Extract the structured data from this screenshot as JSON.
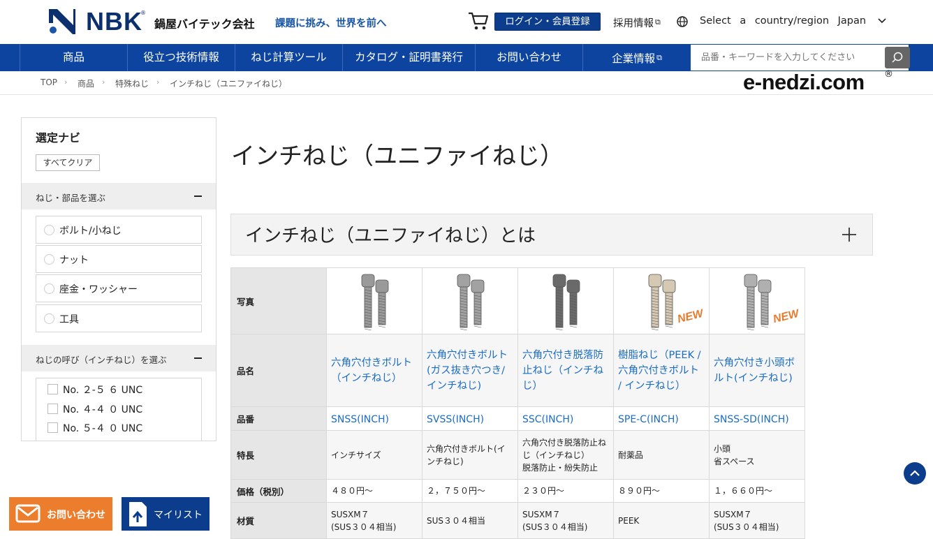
{
  "header": {
    "brand": "NBK",
    "brand_reg": "®",
    "company": "鍋屋バイテック会社",
    "tagline": "課題に挑み、世界を前へ",
    "login_label": "ログイン・会員登録",
    "recruit_label": "採用情報",
    "country_label": "Select a country/region Japan"
  },
  "nav": {
    "items": [
      "商品",
      "役立つ技術情報",
      "ねじ計算ツール",
      "カタログ・証明書発行",
      "お問い合わせ",
      "企業情報"
    ],
    "search_placeholder": "品番・キーワードを入力してください"
  },
  "breadcrumb": [
    "TOP",
    "商品",
    "特殊ねじ",
    "インチねじ（ユニファイねじ）"
  ],
  "site_logo": {
    "text": "e-nedzi.com",
    "reg": "®"
  },
  "sidebar": {
    "title": "選定ナビ",
    "clear_label": "すべてクリア",
    "section1": "ねじ・部品を選ぶ",
    "parts": [
      "ボルト/小ねじ",
      "ナット",
      "座金・ワッシャー",
      "工具"
    ],
    "section2": "ねじの呼び（インチねじ）を選ぶ",
    "sizes": [
      "No. ２‐５ ６ UNC",
      "No. ４‐４ ０ UNC",
      "No. ５‐４ ０ UNC"
    ]
  },
  "main": {
    "title": "インチねじ（ユニファイねじ）",
    "about_title": "インチねじ（ユニファイねじ）とは"
  },
  "table": {
    "row_labels": {
      "photo": "写真",
      "name": "品名",
      "code": "品番",
      "feature": "特長",
      "price": "価格（税別）",
      "material": "材質"
    },
    "new_badge": "NEW",
    "products": [
      {
        "name": "六角穴付きボルト（インチねじ）",
        "code": "SNSS(INCH)",
        "feature_1": "インチサイズ",
        "feature_2": "",
        "price": "４８０円〜",
        "material_1": "SUSXM７",
        "material_2": "(SUS３０４相当)",
        "color": "#9a9a9a",
        "is_new": false
      },
      {
        "name": "六角穴付きボルト(ガス抜き穴つき/インチねじ)",
        "code": "SVSS(INCH)",
        "feature_1": "六角穴付きボルト(インチねじ)",
        "feature_2": "",
        "price": "２，７５０円〜",
        "material_1": "SUS３０４相当",
        "material_2": "",
        "color": "#a2a2a2",
        "is_new": false
      },
      {
        "name": "六角穴付き脱落防止ねじ（インチねじ）",
        "code": "SSC(INCH)",
        "feature_1": "六角穴付き脱落防止ねじ（インチねじ）",
        "feature_2": "脱落防止・紛失防止",
        "price": "２３０円〜",
        "material_1": "SUSXM７",
        "material_2": "(SUS３０４相当)",
        "color": "#6a6a6a",
        "is_new": false
      },
      {
        "name": "樹脂ねじ（PEEK / 六角穴付きボルト / インチねじ）",
        "code": "SPE-C(INCH)",
        "feature_1": "耐薬品",
        "feature_2": "",
        "price": "８９０円〜",
        "material_1": "PEEK",
        "material_2": "",
        "color": "#d6c9b4",
        "is_new": true
      },
      {
        "name": "六角穴付き小頭ボルト(インチねじ)",
        "code": "SNSS-SD(INCH)",
        "feature_1": "小頭",
        "feature_2": "省スペース",
        "price": "１，６６０円〜",
        "material_1": "SUSXM７",
        "material_2": "(SUS３０４相当)",
        "color": "#b0b0b0",
        "is_new": true
      }
    ]
  },
  "floating": {
    "contact_label": "お問い合わせ",
    "mylist_label": "マイリスト"
  },
  "colors": {
    "nav_bg": "#0c44a0",
    "brand_navy": "#0c2f6e",
    "link_blue": "#1a6cc4",
    "accent_orange": "#ec7d2d"
  }
}
